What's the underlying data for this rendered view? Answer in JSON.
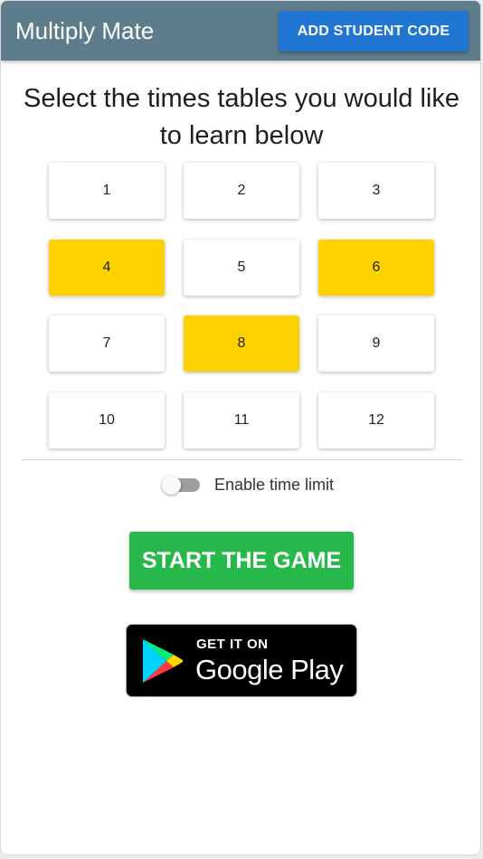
{
  "header": {
    "title": "Multiply Mate",
    "student_code_label": "ADD STUDENT CODE"
  },
  "main": {
    "heading": "Select the times tables you would like to learn below",
    "tables": [
      {
        "label": "1",
        "selected": false
      },
      {
        "label": "2",
        "selected": false
      },
      {
        "label": "3",
        "selected": false
      },
      {
        "label": "4",
        "selected": true
      },
      {
        "label": "5",
        "selected": false
      },
      {
        "label": "6",
        "selected": true
      },
      {
        "label": "7",
        "selected": false
      },
      {
        "label": "8",
        "selected": true
      },
      {
        "label": "9",
        "selected": false
      },
      {
        "label": "10",
        "selected": false
      },
      {
        "label": "11",
        "selected": false
      },
      {
        "label": "12",
        "selected": false
      }
    ],
    "time_limit": {
      "label": "Enable time limit",
      "enabled": false
    },
    "start_label": "START THE GAME"
  },
  "store_badge": {
    "small_text": "GET IT ON",
    "big_text": "Google Play",
    "icon": "google-play-icon"
  },
  "colors": {
    "appbar": "#5e7d8c",
    "accent_button": "#1f77d3",
    "selected_tile": "#ffd100",
    "start_button": "#27b84b"
  }
}
